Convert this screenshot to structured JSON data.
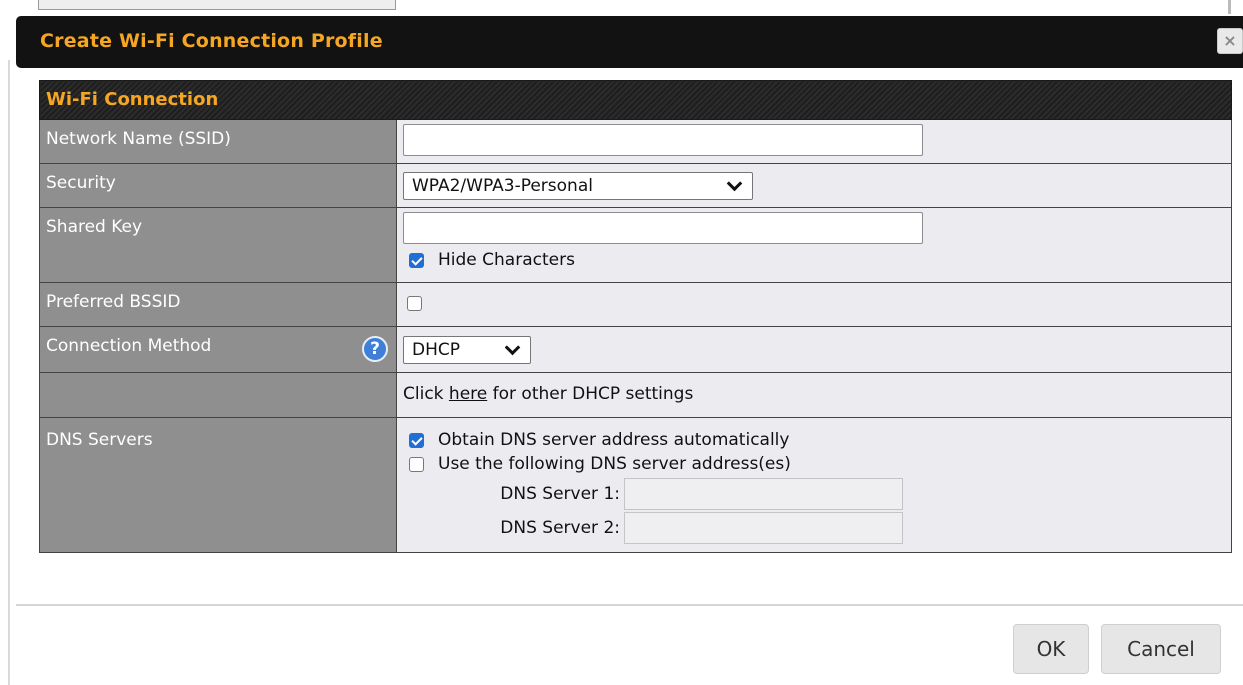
{
  "dialog": {
    "title": "Create Wi-Fi Connection Profile",
    "close_label": "×"
  },
  "section": {
    "title": "Wi-Fi Connection"
  },
  "fields": {
    "ssid": {
      "label": "Network Name (SSID)",
      "value": ""
    },
    "security": {
      "label": "Security",
      "selected": "WPA2/WPA3-Personal"
    },
    "shared_key": {
      "label": "Shared Key",
      "value": "",
      "hide_label": "Hide Characters",
      "hide_checked": true
    },
    "bssid": {
      "label": "Preferred BSSID",
      "checked": false
    },
    "connection_method": {
      "label": "Connection Method",
      "help_icon": "?",
      "selected": "DHCP"
    },
    "dhcp_note": {
      "prefix": "Click ",
      "link": "here",
      "suffix": " for other DHCP settings"
    },
    "dns": {
      "label": "DNS Servers",
      "auto_label": "Obtain DNS server address automatically",
      "auto_checked": true,
      "manual_label": "Use the following DNS server address(es)",
      "manual_checked": false,
      "server1_label": "DNS Server 1:",
      "server2_label": "DNS Server 2:",
      "server1_value": "",
      "server2_value": ""
    }
  },
  "buttons": {
    "ok": "OK",
    "cancel": "Cancel"
  },
  "colors": {
    "title_accent": "#f5a623",
    "title_bar": "#121212",
    "label_bg": "#8f8f8f",
    "value_bg": "#ecebef",
    "checkbox_on": "#1f6fd6"
  }
}
